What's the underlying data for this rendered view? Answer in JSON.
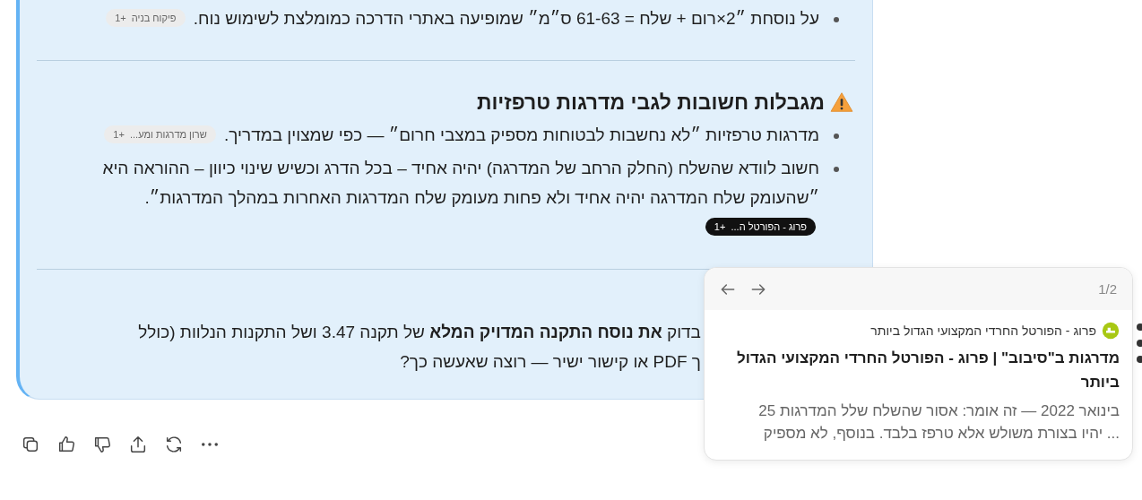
{
  "sections": [
    {
      "kind": "list",
      "items": [
        {
          "text": "על נוסחת ״2×רום + שלח = 61-63 ס״מ״ שמופיעה באתרי הדרכה כמומלצת לשימוש נוח.",
          "chips": [
            {
              "label": "פיקוח בניה",
              "count": "+1",
              "selected": false
            }
          ]
        }
      ]
    },
    {
      "kind": "warning",
      "heading": "מגבלות חשובות לגבי מדרגות טרפזיות",
      "items": [
        {
          "text": "מדרגות טרפזיות ״לא נחשבות לבטוחות מספיק במצבי חרום״ — כפי שמצוין במדריך.",
          "chips": [
            {
              "label": "שרון מדרגות ומע...",
              "count": "+1",
              "selected": false
            }
          ]
        },
        {
          "text": "חשוב לוודא שהשלח (החלק הרחב של המדרגה) יהיה אחיד – בכל הדרג וכשיש שינוי כיוון – ההוראה היא ״שהעומק שלח המדרגה יהיה אחיד ולא פחות מעומק שלח המדרגות האחרות במהלך המדרגות״.",
          "chips": [
            {
              "label": "פרוג - הפורטל ה...",
              "count": "+1",
              "selected": true
            }
          ]
        }
      ]
    },
    {
      "kind": "paragraph",
      "lines": [
        "בדוק **את נוסח התקנה המדויק המלא** של תקנה 3.47 ושל התקנות הנלוות (כולל",
        "ך PDF או קישור ישיר — רוצה שאעשה כך?"
      ]
    }
  ],
  "actions": [
    {
      "kind": "copy"
    },
    {
      "kind": "like"
    },
    {
      "kind": "dislike"
    },
    {
      "kind": "share"
    },
    {
      "kind": "retry"
    },
    {
      "kind": "more"
    }
  ],
  "source_popup": {
    "counter": "1/2",
    "site": "פרוג - הפורטל החרדי המקצועי הגדול ביותר",
    "title": "מדרגות ב\"סיבוב\" | פרוג - הפורטל החרדי המקצועי הגדול ביותר",
    "snippet": [
      "בינואר 2022 — זה אומר: אסור שהשלח שלל המדרגות 25",
      "... יהיו בצורת משולש אלא טרפז בלבד. בנוסף, לא מספיק"
    ]
  }
}
